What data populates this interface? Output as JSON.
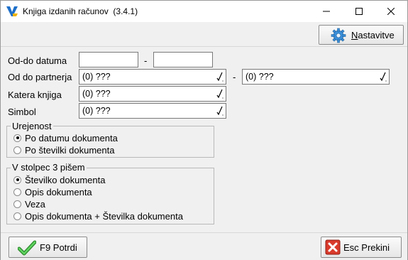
{
  "window": {
    "title": "Knjiga izdanih računov",
    "version": "(3.4.1)",
    "minimize_glyph": "—",
    "close_glyph": "✕"
  },
  "toolbar": {
    "settings_prefix": "N",
    "settings_rest": "astavitve",
    "settings_icon": "gear-icon"
  },
  "form": {
    "date_range": {
      "label": "Od-do datuma",
      "from": "",
      "to": "",
      "separator": "-"
    },
    "partner_range": {
      "label": "Od do partnerja",
      "from": "(0) ???",
      "to": "(0) ???",
      "separator": "-"
    },
    "book_type": {
      "label": "Katera knjiga",
      "value": "(0) ???"
    },
    "symbol": {
      "label": "Simbol",
      "value": "(0) ???"
    }
  },
  "sorting": {
    "title": "Urejenost",
    "options": [
      {
        "label": "Po datumu dokumenta",
        "selected": true
      },
      {
        "label": "Po številki dokumenta",
        "selected": false
      }
    ]
  },
  "column3": {
    "title": "V stolpec 3 pišem",
    "options": [
      {
        "label": "Številko dokumenta",
        "selected": true
      },
      {
        "label": "Opis dokumenta",
        "selected": false
      },
      {
        "label": "Veza",
        "selected": false
      },
      {
        "label": "Opis dokumenta + Številka dokumenta",
        "selected": false
      }
    ]
  },
  "footer": {
    "confirm_label": "F9 Potrdi",
    "cancel_label": "Esc Prekini"
  },
  "colors": {
    "accent_green": "#3aa33a",
    "cancel_red": "#d93a2b",
    "gear_blue": "#3a8fd9"
  }
}
